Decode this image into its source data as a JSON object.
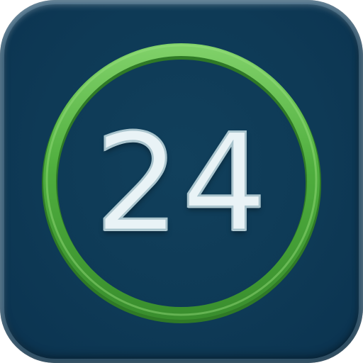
{
  "app_icon": {
    "number": "24",
    "icon": "green-ring-icon",
    "colors": {
      "tile_background": "#0e3a56",
      "ring": "#49a83a",
      "ring_highlight": "#7fd068",
      "number_fill": "#e9f3f6",
      "number_outline": "#a9c4cd"
    }
  }
}
